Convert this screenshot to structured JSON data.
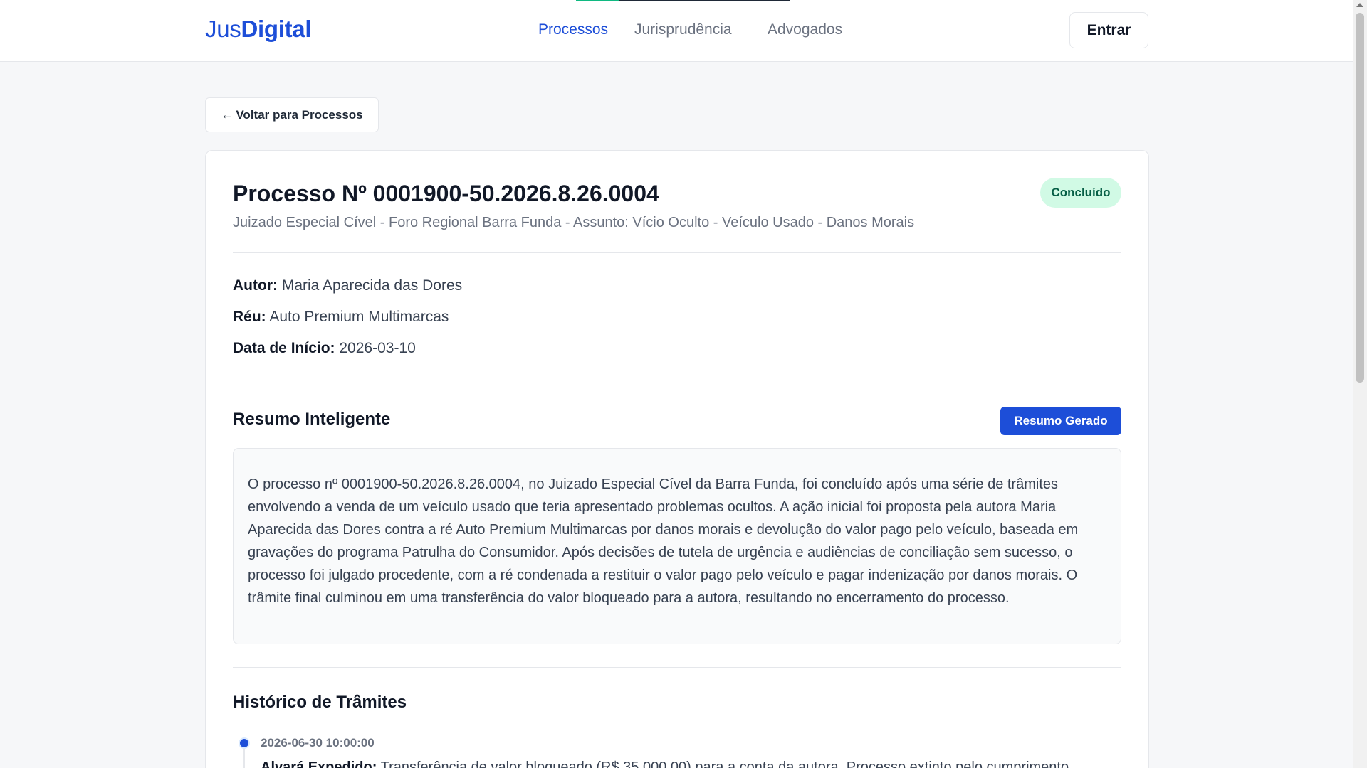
{
  "header": {
    "logo": {
      "part1": "Jus",
      "part2": "Digital"
    },
    "nav": [
      {
        "label": "Processos"
      },
      {
        "label": "Jurisprudência"
      },
      {
        "label": "Advogados"
      }
    ],
    "login_label": "Entrar"
  },
  "back_button": {
    "arrow": "←",
    "label": "Voltar para Processos"
  },
  "process": {
    "title": "Processo Nº 0001900-50.2026.8.26.0004",
    "subtitle": "Juizado Especial Cível - Foro Regional Barra Funda - Assunto: Vício Oculto - Veículo Usado - Danos Morais",
    "status": "Concluído",
    "author_label": "Autor:",
    "author": "Maria Aparecida das Dores",
    "defendant_label": "Réu:",
    "defendant": "Auto Premium Multimarcas",
    "start_label": "Data de Início:",
    "start_date": "2026-03-10"
  },
  "summary": {
    "title": "Resumo Inteligente",
    "button_label": "Resumo Gerado",
    "text": "O processo nº 0001900-50.2026.8.26.0004, no Juizado Especial Cível da Barra Funda, foi concluído após uma série de trâmites envolvendo a venda de um veículo usado que teria apresentado problemas ocultos. A ação inicial foi proposta pela autora Maria Aparecida das Dores contra a ré Auto Premium Multimarcas por danos morais e devolução do valor pago pelo veículo, baseada em gravações do programa Patrulha do Consumidor. Após decisões de tutela de urgência e audiências de conciliação sem sucesso, o processo foi julgado procedente, com a ré condenada a restituir o valor pago pelo veículo e pagar indenização por danos morais. O trâmite final culminou em uma transferência do valor bloqueado para a autora, resultando no encerramento do processo."
  },
  "history": {
    "title": "Histórico de Trâmites",
    "items": [
      {
        "date": "2026-06-30 10:00:00",
        "label": "Alvará Expedido:",
        "text": "Transferência de valor bloqueado (R$ 35.000,00) para a conta da autora. Processo extinto pelo cumprimento"
      }
    ]
  },
  "colors": {
    "accent": "#1d4ed8",
    "status_bg": "#d1fae5",
    "status_text": "#065f46"
  }
}
